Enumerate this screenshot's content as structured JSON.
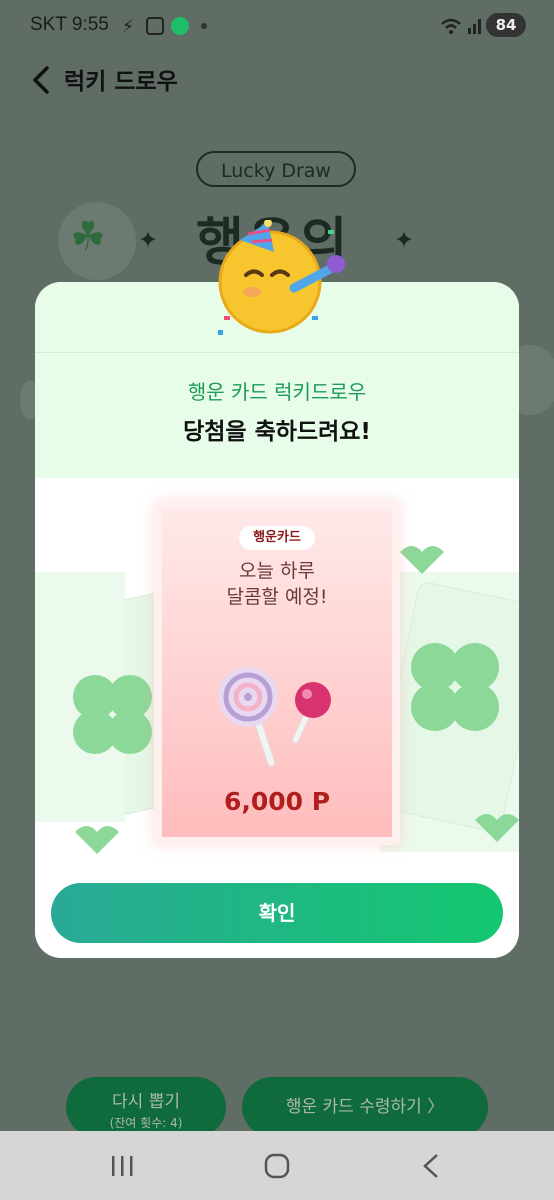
{
  "status_bar": {
    "carrier_time": "SKT 9:55",
    "battery": "84"
  },
  "header": {
    "title": "럭키 드로우"
  },
  "background": {
    "pill": "Lucky Draw",
    "big_title": "행운의"
  },
  "modal": {
    "subtitle": "행운 카드 럭키드로우",
    "title": "당첨을 축하드려요!",
    "card": {
      "tag": "행운카드",
      "line1": "오늘 하루",
      "line2": "달콤할 예정!",
      "points": "6,000 P"
    },
    "confirm_label": "확인"
  },
  "bottom": {
    "redraw_label": "다시 뽑기",
    "redraw_remaining": "(잔여 횟수: 4)",
    "receive_label": "행운 카드 수령하기 〉"
  },
  "colors": {
    "accent_green": "#14c76f",
    "points_red": "#b01e1e",
    "dim_overlay": "#5f6d64"
  },
  "icons": [
    "back-arrow-icon",
    "wifi-icon",
    "signal-icon",
    "battery-icon",
    "clover-icon",
    "sparkle-icon",
    "party-emoji-icon",
    "lollipop-icon",
    "recent-apps-icon",
    "home-icon",
    "back-nav-icon"
  ]
}
